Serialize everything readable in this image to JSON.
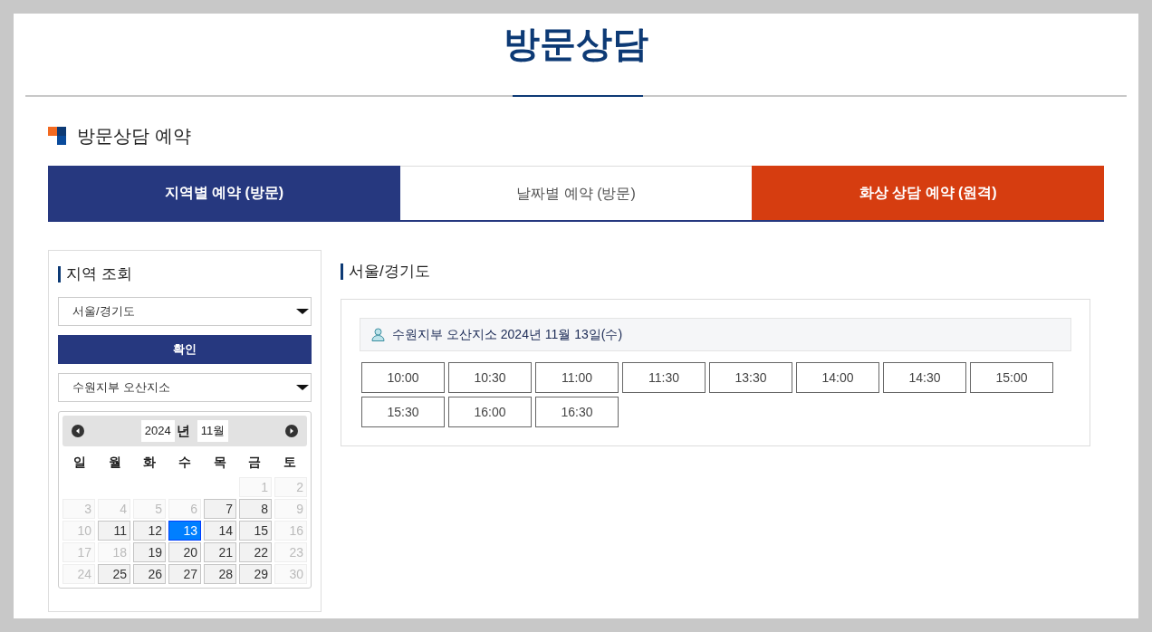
{
  "page_title": "방문상담",
  "section_title": "방문상담 예약",
  "tabs": [
    {
      "label": "지역별 예약 (방문)",
      "selected": true,
      "kind": "visit"
    },
    {
      "label": "날짜별 예약 (방문)",
      "selected": false,
      "kind": "visit"
    },
    {
      "label": "화상 상담 예약 (원격)",
      "selected": false,
      "kind": "video"
    }
  ],
  "sidebar": {
    "heading": "지역 조회",
    "region_select": "서울/경기도",
    "confirm_button": "확인",
    "office_select": "수원지부 오산지소",
    "calendar": {
      "year_select": "2024",
      "year_suffix": "년",
      "month_select": "11월",
      "weekdays": [
        "일",
        "월",
        "화",
        "수",
        "목",
        "금",
        "토"
      ],
      "days": [
        {
          "label": "1",
          "available": false,
          "selected": false
        },
        {
          "label": "2",
          "available": false,
          "selected": false
        },
        {
          "label": "3",
          "available": false,
          "selected": false
        },
        {
          "label": "4",
          "available": false,
          "selected": false
        },
        {
          "label": "5",
          "available": false,
          "selected": false
        },
        {
          "label": "6",
          "available": false,
          "selected": false
        },
        {
          "label": "7",
          "available": true,
          "selected": false
        },
        {
          "label": "8",
          "available": true,
          "selected": false
        },
        {
          "label": "9",
          "available": false,
          "selected": false
        },
        {
          "label": "10",
          "available": false,
          "selected": false
        },
        {
          "label": "11",
          "available": true,
          "selected": false
        },
        {
          "label": "12",
          "available": true,
          "selected": false
        },
        {
          "label": "13",
          "available": true,
          "selected": true
        },
        {
          "label": "14",
          "available": true,
          "selected": false
        },
        {
          "label": "15",
          "available": true,
          "selected": false
        },
        {
          "label": "16",
          "available": false,
          "selected": false
        },
        {
          "label": "17",
          "available": false,
          "selected": false
        },
        {
          "label": "18",
          "available": false,
          "selected": false
        },
        {
          "label": "19",
          "available": true,
          "selected": false
        },
        {
          "label": "20",
          "available": true,
          "selected": false
        },
        {
          "label": "21",
          "available": true,
          "selected": false
        },
        {
          "label": "22",
          "available": true,
          "selected": false
        },
        {
          "label": "23",
          "available": false,
          "selected": false
        },
        {
          "label": "24",
          "available": false,
          "selected": false
        },
        {
          "label": "25",
          "available": true,
          "selected": false
        },
        {
          "label": "26",
          "available": true,
          "selected": false
        },
        {
          "label": "27",
          "available": true,
          "selected": false
        },
        {
          "label": "28",
          "available": true,
          "selected": false
        },
        {
          "label": "29",
          "available": true,
          "selected": false
        },
        {
          "label": "30",
          "available": false,
          "selected": false
        }
      ]
    }
  },
  "content": {
    "heading": "서울/경기도",
    "office_date": "수원지부 오산지소 2024년 11월 13일(수)",
    "time_slots": [
      "10:00",
      "10:30",
      "11:00",
      "11:30",
      "13:30",
      "14:00",
      "14:30",
      "15:00",
      "15:30",
      "16:00",
      "16:30"
    ]
  }
}
